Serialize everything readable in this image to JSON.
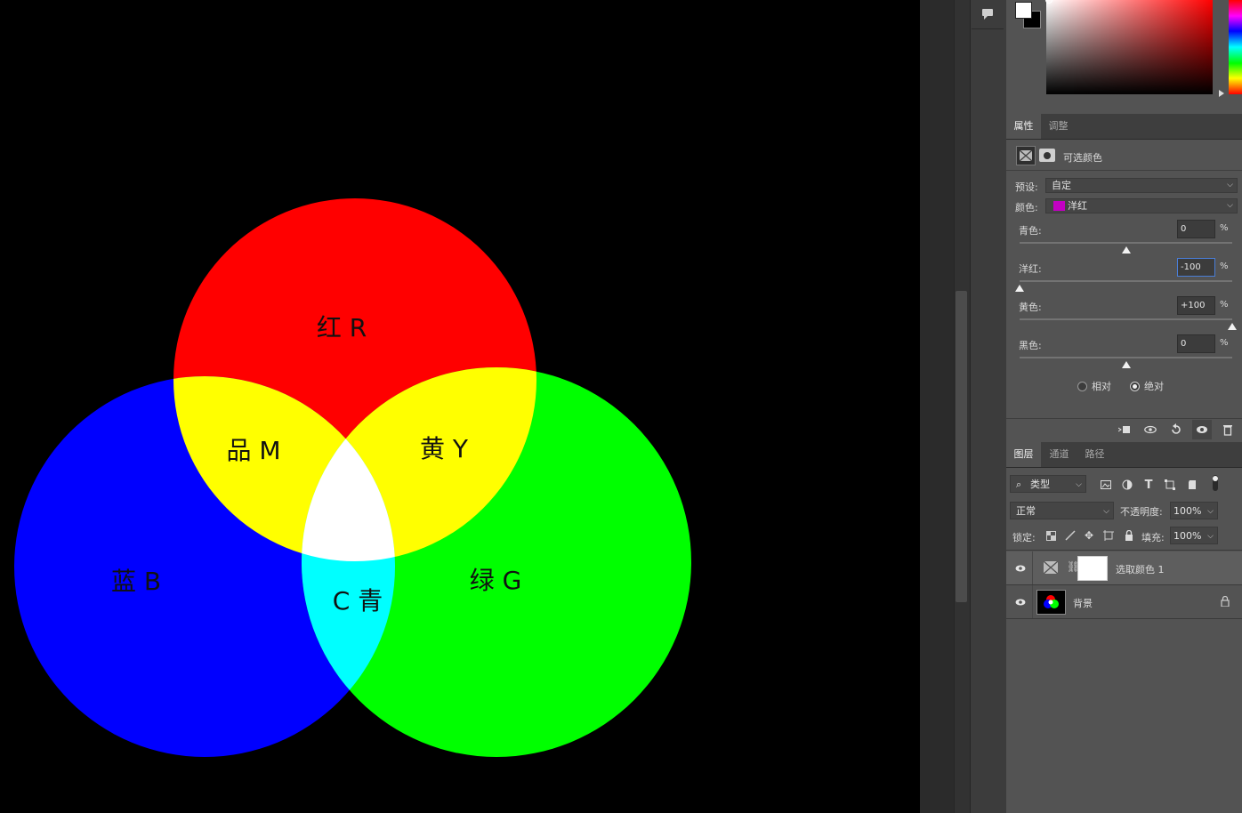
{
  "canvas": {
    "labels": {
      "red": "红 R",
      "green": "绿 G",
      "blue": "蓝 B",
      "magenta": "品 M",
      "yellow": "黄 Y",
      "cyan": "C 青"
    },
    "colors": {
      "red": "#ff0000",
      "green": "#00ff00",
      "blue": "#0000ff",
      "magenta_area": "#ffff00",
      "yellow_area": "#ffff00",
      "cyan_area": "#00ffff",
      "center": "#ffffff",
      "background": "#000000"
    }
  },
  "color_picker": {
    "foreground": "#ffffff",
    "background": "#000000"
  },
  "properties_panel": {
    "tabs": [
      "属性",
      "调整"
    ],
    "active_tab": "属性",
    "adjustment_name": "可选颜色",
    "preset_label": "预设:",
    "preset_value": "自定",
    "color_label": "颜色:",
    "color_value": "洋红",
    "color_swatch": "#c300c3",
    "sliders": [
      {
        "label": "青色:",
        "value": "0",
        "unit": "%",
        "level": 0
      },
      {
        "label": "洋红:",
        "value": "-100",
        "unit": "%",
        "level": -100,
        "focused": true
      },
      {
        "label": "黄色:",
        "value": "+100",
        "unit": "%",
        "level": 100
      },
      {
        "label": "黑色:",
        "value": "0",
        "unit": "%",
        "level": 0
      }
    ],
    "method_options": [
      "相对",
      "绝对"
    ],
    "method_selected": "绝对"
  },
  "layers_panel": {
    "tabs": [
      "图层",
      "通道",
      "路径"
    ],
    "active_tab": "图层",
    "filter_kind": "类型",
    "blend_mode": "正常",
    "opacity_label": "不透明度:",
    "opacity_value": "100%",
    "lock_label": "锁定:",
    "fill_label": "填充:",
    "fill_value": "100%",
    "layers": [
      {
        "name": "选取颜色 1",
        "visible": true,
        "selected": true
      },
      {
        "name": "背景",
        "visible": true,
        "locked": true
      }
    ]
  }
}
